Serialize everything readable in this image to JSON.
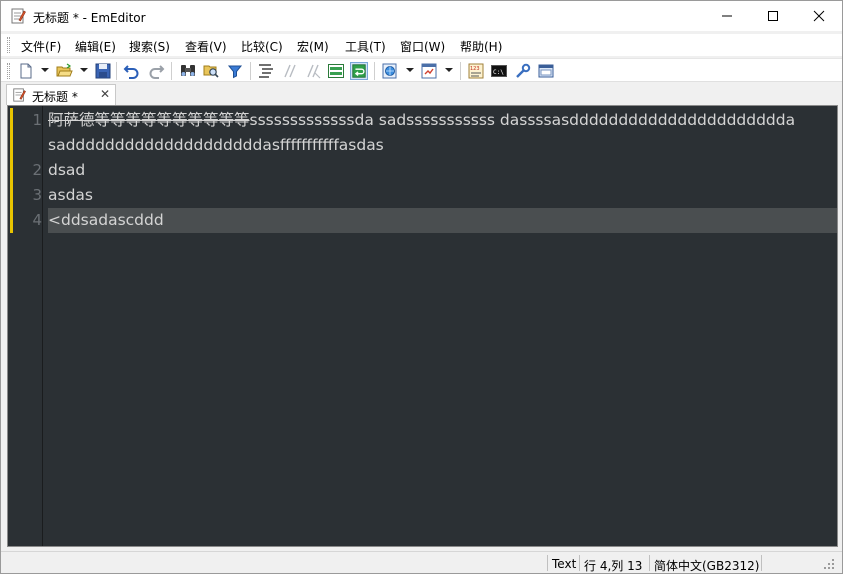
{
  "window": {
    "title": "无标题 * - EmEditor"
  },
  "menu": {
    "items": [
      {
        "label": "文件(F)"
      },
      {
        "label": "编辑(E)"
      },
      {
        "label": "搜索(S)"
      },
      {
        "label": "查看(V)"
      },
      {
        "label": "比较(C)"
      },
      {
        "label": "宏(M)"
      },
      {
        "label": "工具(T)"
      },
      {
        "label": "窗口(W)"
      },
      {
        "label": "帮助(H)"
      }
    ]
  },
  "toolbar": {
    "icons": [
      "new-file-icon",
      "open-folder-icon",
      "save-icon",
      "undo-icon",
      "redo-icon",
      "find-icon",
      "find-in-files-icon",
      "filter-icon",
      "format-icon",
      "comment-icon",
      "uncomment-icon",
      "highlight-icon",
      "wrap-icon",
      "web-icon",
      "view-icon",
      "ruler-icon",
      "console-icon",
      "tools-icon",
      "window-icon"
    ]
  },
  "tab": {
    "label": "无标题 *",
    "close": "✕"
  },
  "editor": {
    "lines": [
      {
        "number": "1",
        "segments": [
          {
            "text": "阿萨德等等等等等等等等等等",
            "strike": true
          },
          {
            "text": "sssssssssssssda sadsssssssssss dassssasdddddddddddddddddddddda",
            "strike": false
          }
        ]
      },
      {
        "number": "",
        "segments": [
          {
            "text": "saddddddddddddddddddddasfffffffffffasdas",
            "strike": false
          }
        ]
      },
      {
        "number": "2",
        "segments": [
          {
            "text": "dsad",
            "strike": false
          }
        ]
      },
      {
        "number": "3",
        "segments": [
          {
            "text": "asdas",
            "strike": false
          }
        ]
      },
      {
        "number": "4",
        "segments": [
          {
            "text": "<ddsadascddd",
            "strike": false
          }
        ]
      }
    ],
    "colors": {
      "background": "#2b3034",
      "text": "#d4d4d4",
      "current_line": "#4a4e50",
      "modified_marker": "#e8c400"
    }
  },
  "status": {
    "mode": "Text",
    "position": "行 4,列 13",
    "encoding": "简体中文(GB2312)"
  }
}
